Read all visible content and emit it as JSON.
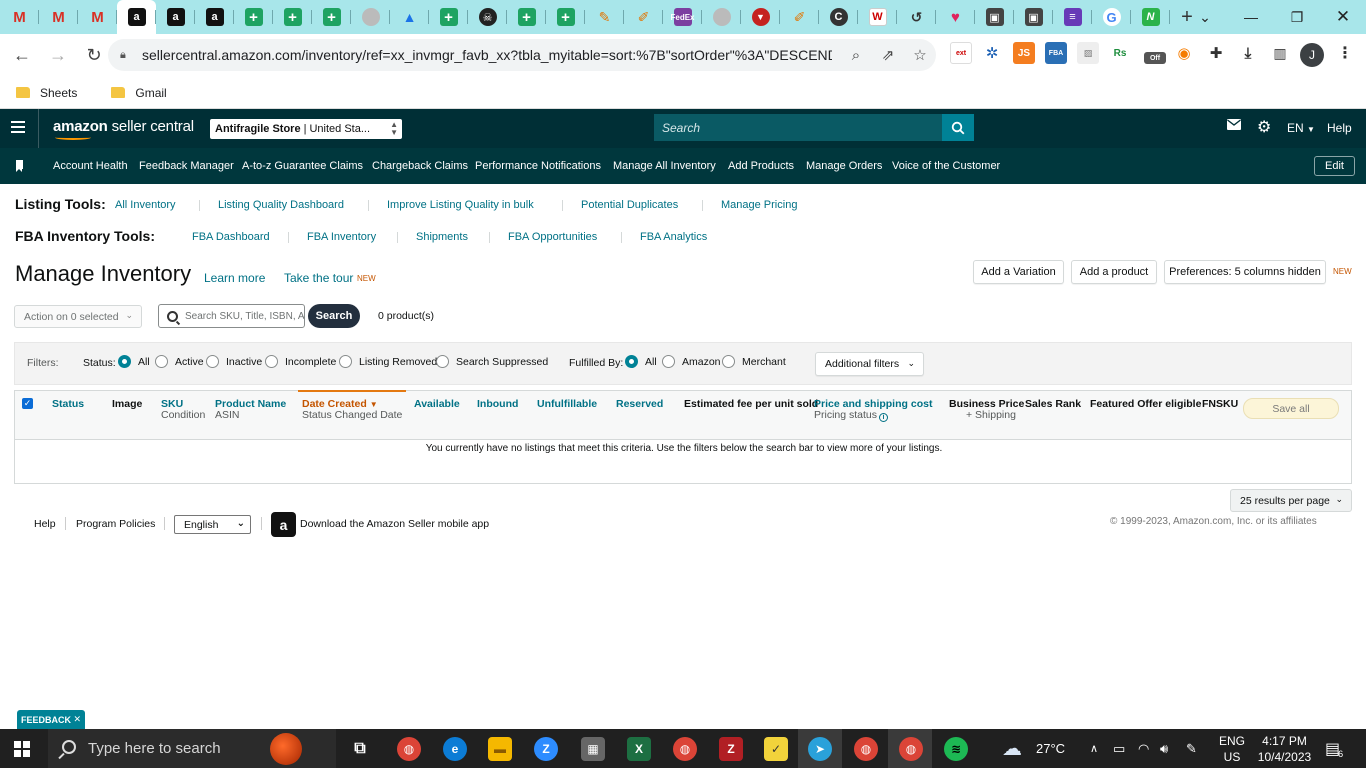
{
  "browser": {
    "url": "sellercentral.amazon.com/inventory/ref=xx_invmgr_favb_xx?tbla_myitable=sort:%7B\"sortOrder\"%3A\"DESCENDI...",
    "bookmarks": [
      "Sheets",
      "Gmail"
    ],
    "profile_initial": "J"
  },
  "header": {
    "logo_brand": "amazon",
    "logo_product": "seller central",
    "store_name": "Antifragile Store",
    "store_region": "| United Sta...",
    "search_placeholder": "Search",
    "language": "EN",
    "help": "Help"
  },
  "nav": {
    "items": [
      "Account Health",
      "Feedback Manager",
      "A-to-z Guarantee Claims",
      "Chargeback Claims",
      "Performance Notifications",
      "Manage All Inventory",
      "Add Products",
      "Manage Orders",
      "Voice of the Customer"
    ],
    "edit": "Edit"
  },
  "listing_tools": {
    "label": "Listing Tools:",
    "links": [
      "All Inventory",
      "Listing Quality Dashboard",
      "Improve Listing Quality in bulk",
      "Potential Duplicates",
      "Manage Pricing"
    ]
  },
  "fba_tools": {
    "label": "FBA Inventory Tools:",
    "links": [
      "FBA Dashboard",
      "FBA Inventory",
      "Shipments",
      "FBA Opportunities",
      "FBA Analytics"
    ]
  },
  "page": {
    "title": "Manage Inventory",
    "learn_more": "Learn more",
    "take_tour": "Take the tour",
    "new_badge": "NEW",
    "add_variation": "Add a Variation",
    "add_product": "Add a product",
    "preferences": "Preferences: 5 columns hidden",
    "preferences_badge": "NEW"
  },
  "search": {
    "action_select": "Action on 0 selected",
    "placeholder": "Search SKU, Title, ISBN, A",
    "button": "Search",
    "count": "0 product(s)"
  },
  "filters": {
    "label": "Filters:",
    "status_label": "Status:",
    "status_options": [
      "All",
      "Active",
      "Inactive",
      "Incomplete",
      "Listing Removed",
      "Search Suppressed"
    ],
    "status_selected": "All",
    "fulfilled_label": "Fulfilled By:",
    "fulfilled_options": [
      "All",
      "Amazon",
      "Merchant"
    ],
    "fulfilled_selected": "All",
    "additional": "Additional filters"
  },
  "table": {
    "columns": {
      "status": "Status",
      "image": "Image",
      "sku": "SKU",
      "sku_sub": "Condition",
      "product_name": "Product Name",
      "product_sub": "ASIN",
      "date_created": "Date Created",
      "date_sub": "Status Changed Date",
      "available": "Available",
      "inbound": "Inbound",
      "unfulfillable": "Unfulfillable",
      "reserved": "Reserved",
      "est_fee": "Estimated fee per unit sold",
      "price": "Price and shipping cost",
      "price_sub": "Pricing status",
      "business_price": "Business Price",
      "business_sub": "+ Shipping",
      "sales_rank": "Sales Rank",
      "featured_offer": "Featured Offer eligible",
      "fnsku": "FNSKU"
    },
    "save_all": "Save all",
    "empty_message": "You currently have no listings that meet this criteria. Use the filters below the search bar to view more of your listings.",
    "per_page": "25 results per page"
  },
  "footer": {
    "help": "Help",
    "policies": "Program Policies",
    "language": "English",
    "app_download": "Download the Amazon Seller mobile app",
    "copyright": "© 1999-2023, Amazon.com, Inc. or its affiliates",
    "feedback": "FEEDBACK"
  },
  "taskbar": {
    "search_placeholder": "Type here to search",
    "temperature": "27°C",
    "lang_top": "ENG",
    "lang_bottom": "US",
    "time": "4:17 PM",
    "date": "10/4/2023",
    "notifications": "6"
  },
  "colors": {
    "header_bg": "#002f36",
    "nav_bg": "#00373d",
    "link": "#007185",
    "accent_teal": "#008296",
    "sort_orange": "#c45500"
  }
}
